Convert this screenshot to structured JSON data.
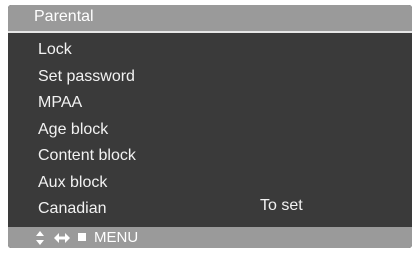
{
  "menu": {
    "title": "Parental",
    "items": [
      {
        "label": "Lock"
      },
      {
        "label": "Set password"
      },
      {
        "label": "MPAA"
      },
      {
        "label": "Age block"
      },
      {
        "label": "Content block"
      },
      {
        "label": "Aux block"
      },
      {
        "label": "Canadian"
      }
    ],
    "selected_value": "To set"
  },
  "bottom_bar": {
    "icons": [
      "up-down-arrow-icon",
      "left-right-arrow-icon",
      "stop-square-icon"
    ],
    "menu_label": "MENU"
  },
  "colors": {
    "background": "#3a3a3a",
    "bar": "#9a9a9a",
    "text": "#f2f2f2"
  }
}
